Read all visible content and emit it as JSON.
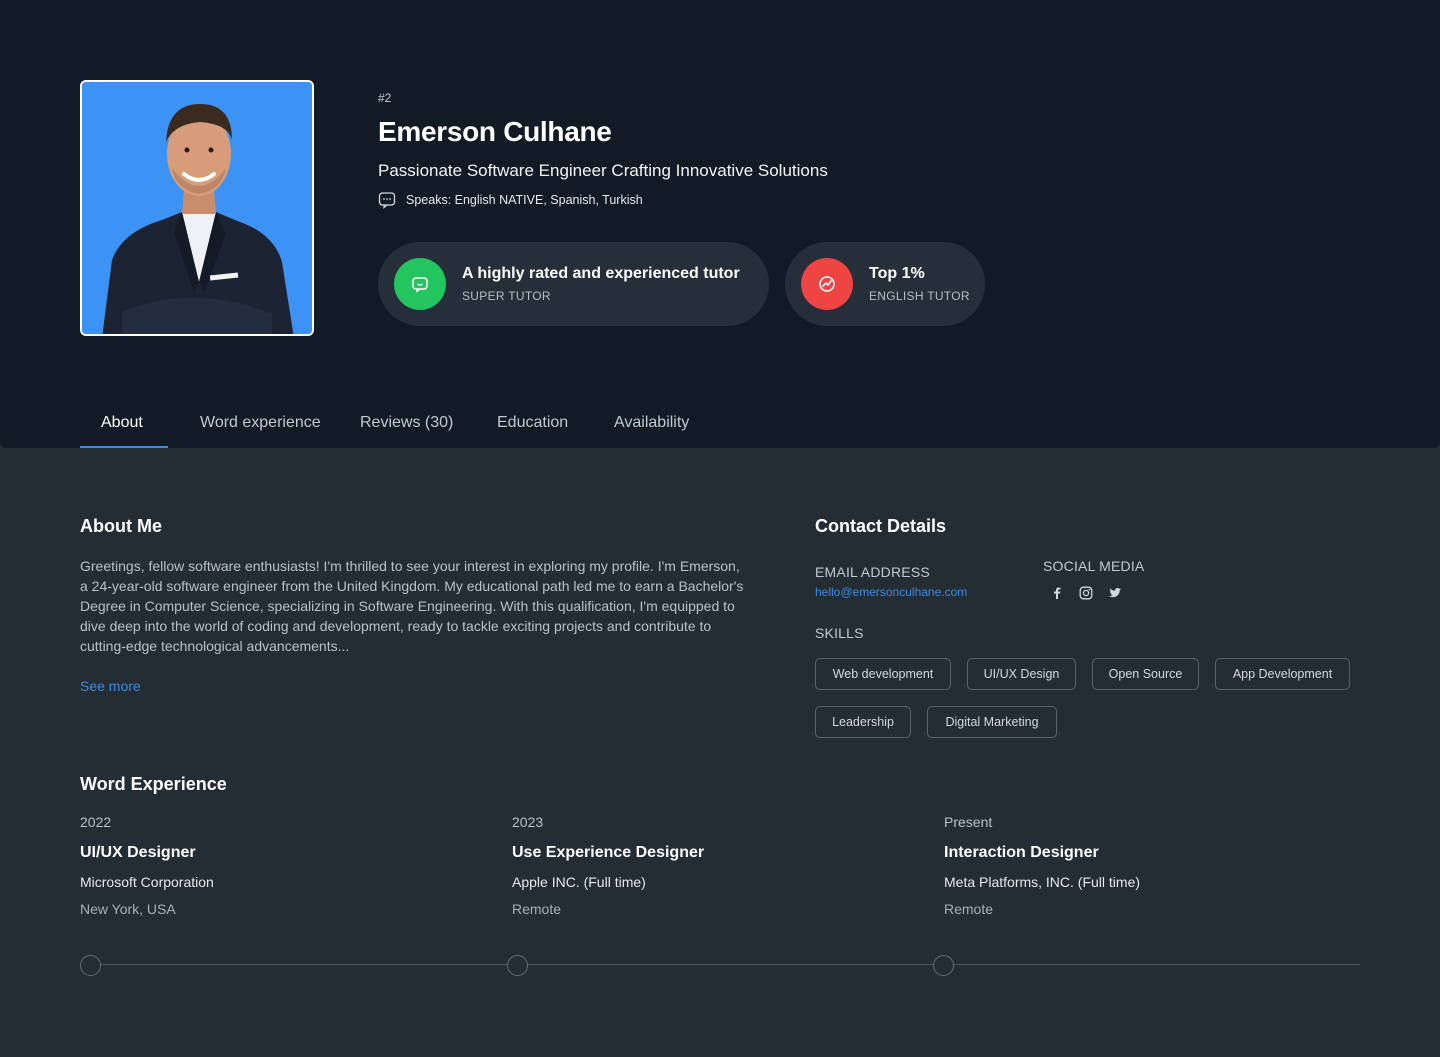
{
  "profile": {
    "rank": "#2",
    "name": "Emerson Culhane",
    "tagline": "Passionate Software Engineer Crafting Innovative Solutions",
    "speaks": "Speaks: English NATIVE, Spanish, Turkish",
    "avatar_icon": "person-portrait"
  },
  "badges": [
    {
      "title": "A highly rated and experienced tutor",
      "subtitle": "SUPER TUTOR",
      "icon": "chat-bubble-icon",
      "color": "#22c55e"
    },
    {
      "title": "Top 1%",
      "subtitle": "ENGLISH TUTOR",
      "icon": "trend-chart-icon",
      "color": "#ef4444"
    }
  ],
  "tabs": [
    {
      "label": "About",
      "active": true
    },
    {
      "label": "Word experience",
      "active": false
    },
    {
      "label": "Reviews (30)",
      "active": false
    },
    {
      "label": "Education",
      "active": false
    },
    {
      "label": "Availability",
      "active": false
    }
  ],
  "about": {
    "title": "About Me",
    "text": "Greetings, fellow software enthusiasts! I'm thrilled to see your interest in exploring my profile. I'm Emerson, a 24-year-old software engineer from the United Kingdom. My educational path led me to earn a Bachelor's Degree in Computer Science, specializing in Software Engineering. With this qualification, I'm equipped to dive deep into the world of coding and development, ready to tackle exciting projects and contribute to cutting-edge technological advancements...",
    "see_more": "See more"
  },
  "contact": {
    "title": "Contact Details",
    "email_label": "EMAIL ADDRESS",
    "email": "hello@emersonculhane.com",
    "social_label": "SOCIAL MEDIA",
    "social_icons": [
      "facebook-icon",
      "instagram-icon",
      "twitter-icon"
    ],
    "skills_label": "SKILLS",
    "skills": [
      "Web development",
      "UI/UX Design",
      "Open Source",
      "App Development",
      "Leadership",
      "Digital Marketing"
    ]
  },
  "experience": {
    "title": "Word Experience",
    "items": [
      {
        "year": "2022",
        "role": "UI/UX Designer",
        "company": "Microsoft Corporation",
        "location": "New York, USA"
      },
      {
        "year": "2023",
        "role": "Use Experience Designer",
        "company": "Apple INC. (Full time)",
        "location": "Remote"
      },
      {
        "year": "Present",
        "role": "Interaction Designer",
        "company": "Meta Platforms, INC. (Full time)",
        "location": "Remote"
      }
    ]
  },
  "colors": {
    "hero_bg": "#121a25",
    "page_bg": "#242c34",
    "accent": "#3b8be6",
    "avatar_bg": "#3d93f5"
  }
}
